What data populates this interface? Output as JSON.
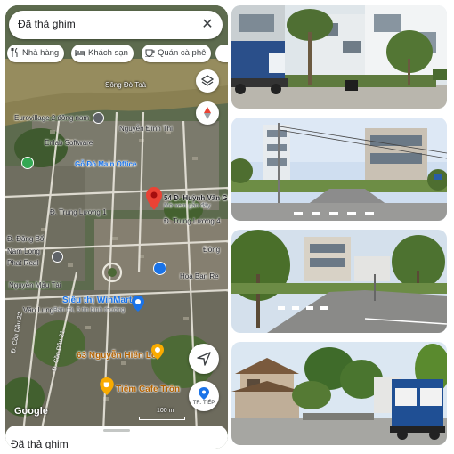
{
  "search": {
    "query": "Đã thả ghim"
  },
  "chips": [
    {
      "label": "Nhà hàng",
      "icon": "restaurant-icon"
    },
    {
      "label": "Khách sạn",
      "icon": "hotel-icon"
    },
    {
      "label": "Quán cà phê",
      "icon": "coffee-icon"
    }
  ],
  "map": {
    "labels": {
      "river": "Sông Đò Toà",
      "eurovillage": "Eurovillage 2 đông nam",
      "enlab": "Enlab Software",
      "main_office": "Gỗ Đỏ Main Office",
      "nguyen_dinh": "Nguyễn Đình Thi",
      "trung_luong": "Đ. Trung Lương 1",
      "dang_bo": "Đ. Đặng Bổ",
      "trung_luong_4": "Đ. Trung Lương 4",
      "nam_long": "Nam Long",
      "phat_real": "Phat Real",
      "dong": "Đông",
      "hoa_ban": "Hoa Ban Re",
      "nguyen_mau_tai": "Nguyễn Mậu Tài",
      "van_lung": "Văn Lung",
      "winmart": "Siêu thị WinMart",
      "winmart_sub": "Bán rồi, 5 tín bình thường",
      "con_dau_22": "Đ. Cồn Dầu 22",
      "con_dau_21": "Đ. Cồn Dầu 21",
      "address": "63 Nguyễn Hiến Lê",
      "cafe": "Tiệm Cafe Trôn",
      "pin_title": "54 Đ. Huỳnh Văn Gấm",
      "pin_sub": "Mở xem gần đây",
      "google": "Google",
      "scale": "100 m"
    },
    "directions_label": "TR. TIẾP"
  },
  "bottom_sheet": {
    "title": "Đã thả ghim"
  },
  "colors": {
    "accent": "#1a73e8",
    "pin": "#ea4335",
    "cafe": "#f9ab00",
    "map_base": "#4a5b3f"
  },
  "photos": [
    {
      "name": "street-photo-1"
    },
    {
      "name": "street-photo-2"
    },
    {
      "name": "street-photo-3"
    },
    {
      "name": "street-photo-4"
    }
  ]
}
